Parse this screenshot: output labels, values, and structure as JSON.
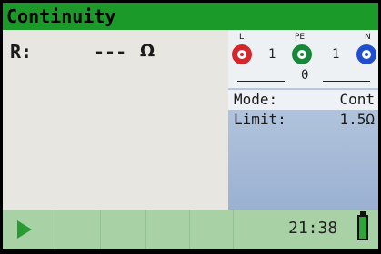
{
  "title": "Continuity",
  "reading": {
    "label": "R:",
    "value": "---",
    "unit": "Ω"
  },
  "terminals": {
    "l_label": "L",
    "pe_label": "PE",
    "n_label": "N",
    "l_pe_value": "1",
    "pe_n_value": "1",
    "l_n_value": "0",
    "colors": {
      "l": "#d5262b",
      "pe": "#17873a",
      "n": "#1f4fcf"
    }
  },
  "settings": {
    "mode_label": "Mode:",
    "mode_value": "Cont",
    "limit_label": "Limit:",
    "limit_value": "1.5Ω"
  },
  "status": {
    "time": "21:38"
  },
  "colors": {
    "title_bar": "#1c9a29",
    "bottom_bar": "#a8d2a6",
    "battery": "#2ea43a"
  }
}
